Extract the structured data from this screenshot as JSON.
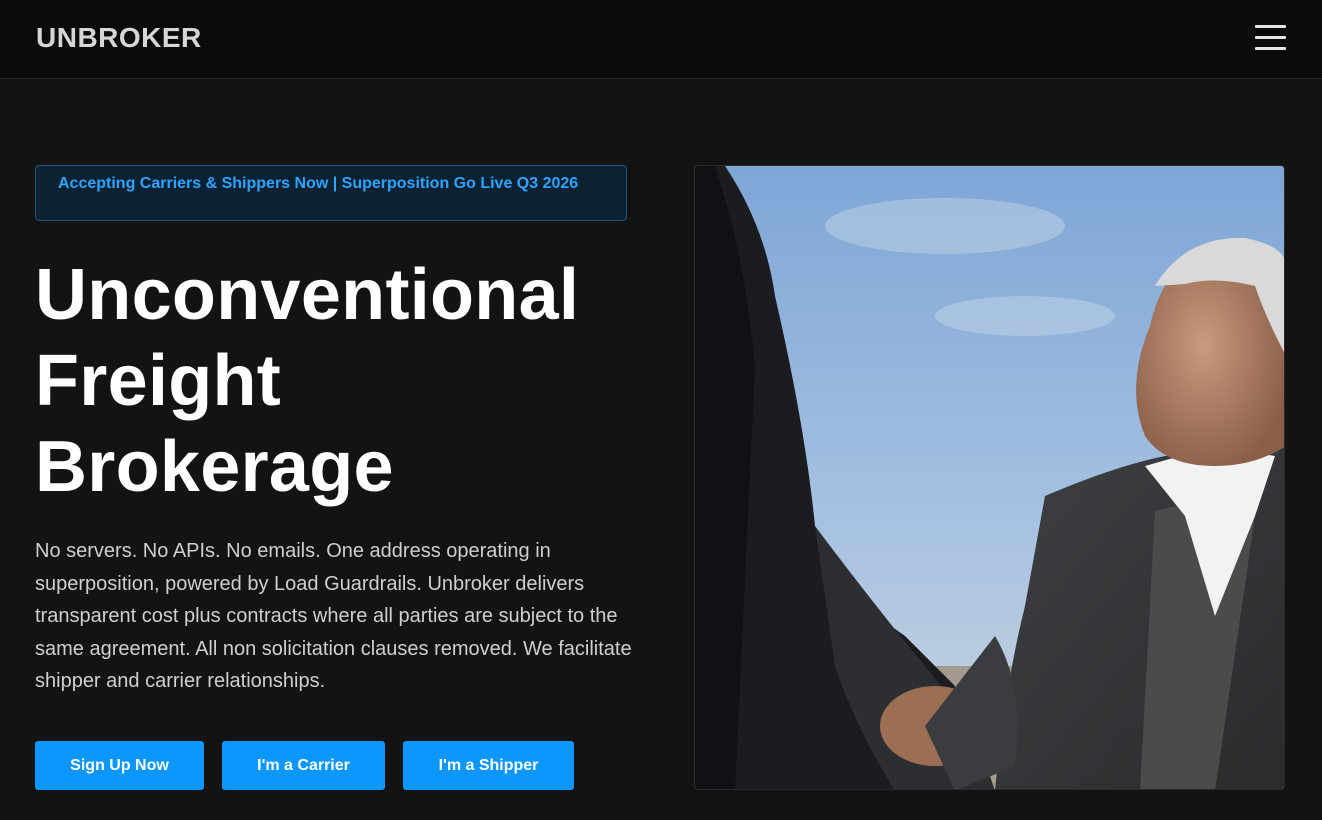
{
  "nav": {
    "logo": "UNBROKER",
    "menu_icon": "hamburger-menu-icon"
  },
  "hero": {
    "badge": "Accepting Carriers & Shippers Now | Superposition Go Live Q3 2026",
    "title_lines": [
      "Unconventional",
      "Freight",
      "Brokerage"
    ],
    "description": "No servers. No APIs. No emails. One address operating in superposition, powered by Load Guardrails. Unbroker delivers transparent cost plus contracts where all parties are subject to the same agreement. All non solicitation clauses removed. We facilitate shipper and carrier relationships.",
    "buttons": {
      "signup": "Sign Up Now",
      "carrier": "I'm a Carrier",
      "shipper": "I'm a Shipper"
    }
  },
  "colors": {
    "accent": "#0c96ff",
    "badge_text": "#2ea3ff",
    "background": "#131313"
  }
}
